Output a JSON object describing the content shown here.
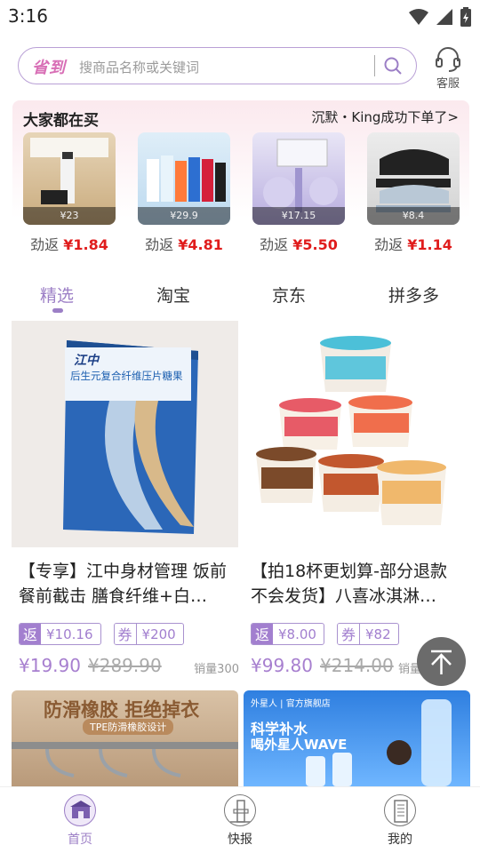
{
  "status_bar": {
    "time": "3:16"
  },
  "search": {
    "logo": "省到",
    "placeholder": "搜商品名称或关键词",
    "service_label": "客服"
  },
  "buying": {
    "title": "大家都在买",
    "notice": "沉默・King成功下单了>",
    "items": [
      {
        "price": "¥23",
        "rebate_label": "劲返",
        "rebate": "¥1.84"
      },
      {
        "price": "¥29.9",
        "rebate_label": "劲返",
        "rebate": "¥4.81"
      },
      {
        "price": "¥17.15",
        "rebate_label": "劲返",
        "rebate": "¥5.50"
      },
      {
        "price": "¥8.4",
        "rebate_label": "劲返",
        "rebate": "¥1.14"
      }
    ]
  },
  "tabs": [
    "精选",
    "淘宝",
    "京东",
    "拼多多"
  ],
  "products": [
    {
      "title": "【专享】江中身材管理 饭前餐前截击 膳食纤维+白…",
      "rebate_key": "返",
      "rebate": "¥10.16",
      "coupon_key": "券",
      "coupon": "¥200",
      "price": "¥19.90",
      "original_price": "¥289.90",
      "sales": "销量300",
      "box_brand": "江中",
      "box_title": "后生元复合纤维压片糖果"
    },
    {
      "title": "【拍18杯更划算-部分退款不会发货】八喜冰淇淋…",
      "rebate_key": "返",
      "rebate": "¥8.00",
      "coupon_key": "券",
      "coupon": "¥82",
      "price": "¥99.80",
      "original_price": "¥214.00",
      "sales": "销量"
    }
  ],
  "bottom_cards": [
    {
      "headline": "防滑橡胶 拒绝掉衣",
      "subline": "TPE防滑橡胶设计"
    },
    {
      "brand": "外星人 | 官方旗舰店",
      "headline": "科学补水",
      "subline": "喝外星人WAVE"
    }
  ],
  "nav": [
    {
      "label": "首页",
      "icon": "home-icon"
    },
    {
      "label": "快报",
      "icon": "news-icon"
    },
    {
      "label": "我的",
      "icon": "profile-icon"
    }
  ],
  "colors": {
    "accent": "#9c7fc6",
    "rebate_red": "#e01c1c"
  }
}
